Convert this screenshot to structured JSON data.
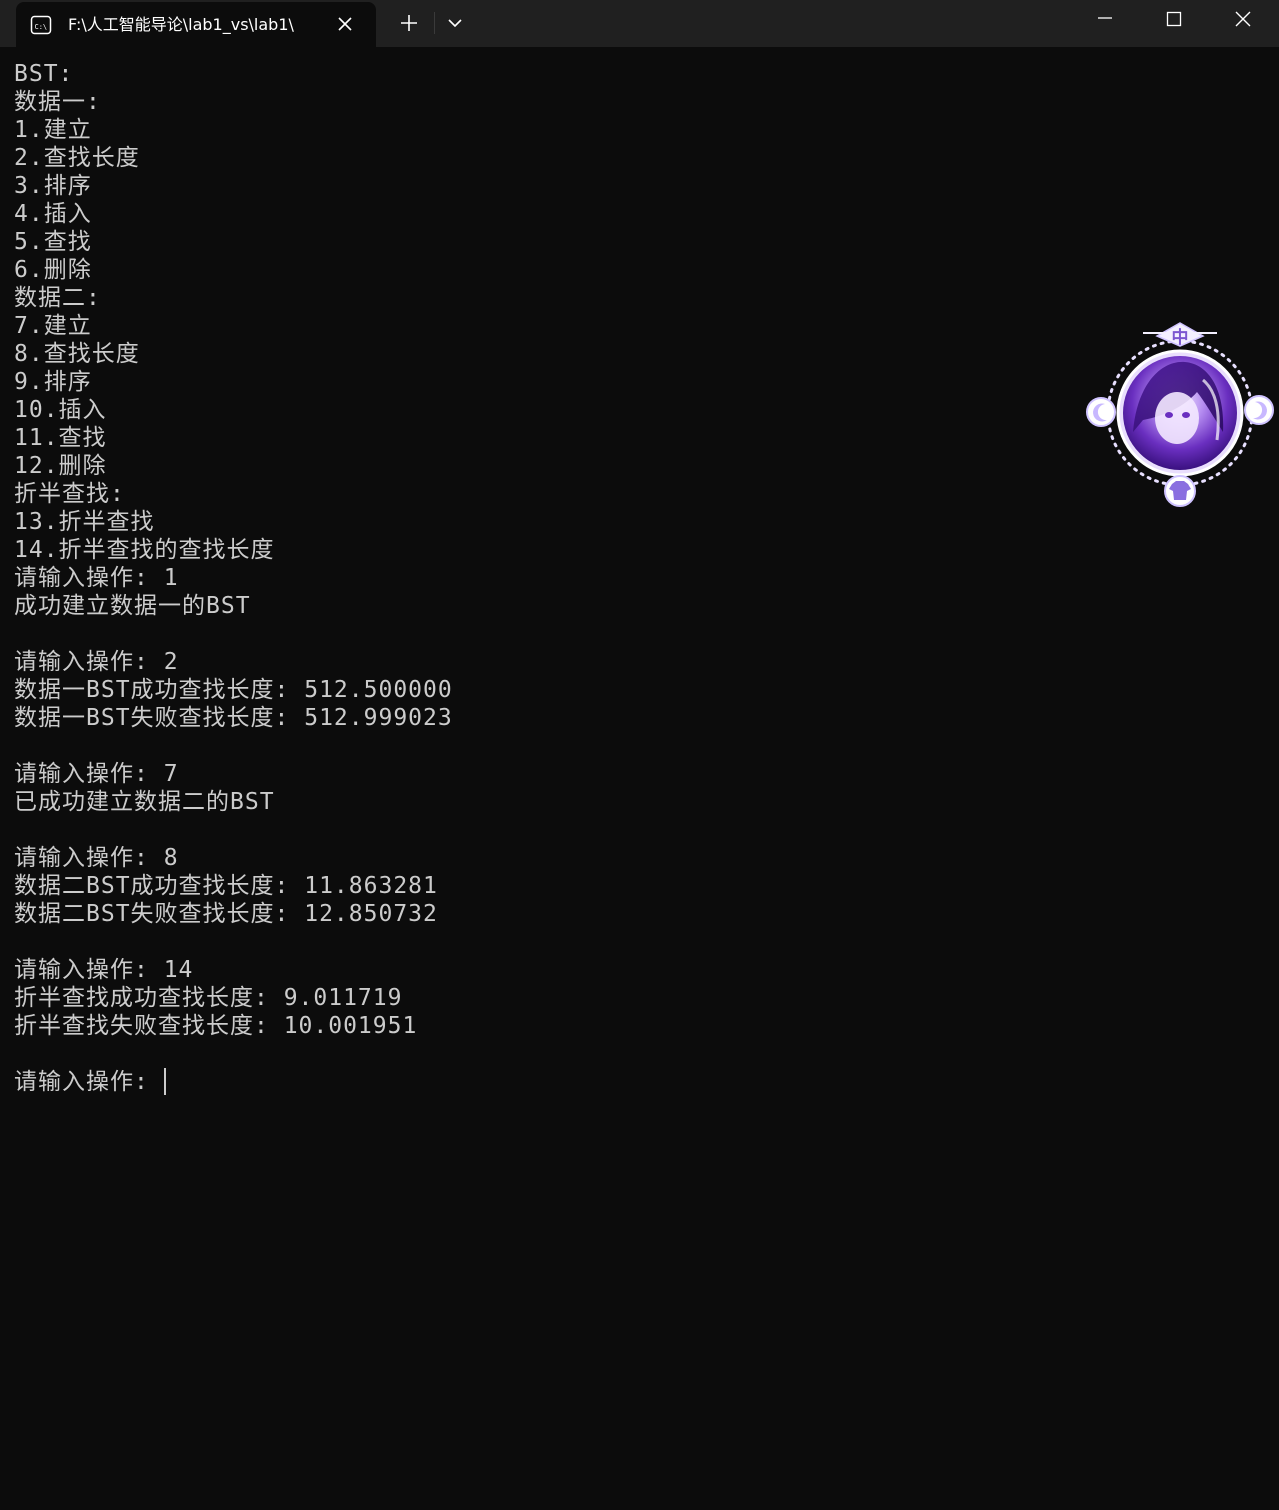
{
  "window": {
    "tab_title": "F:\\人工智能导论\\lab1_vs\\lab1\\",
    "icons": {
      "tab": "terminal-icon",
      "close_tab": "close-icon",
      "new_tab": "plus-icon",
      "tab_menu": "chevron-down-icon",
      "minimize": "minimize-icon",
      "maximize": "maximize-icon",
      "close": "close-icon"
    }
  },
  "console": {
    "lines": [
      "BST:",
      "数据一:",
      "1.建立",
      "2.查找长度",
      "3.排序",
      "4.插入",
      "5.查找",
      "6.删除",
      "数据二:",
      "7.建立",
      "8.查找长度",
      "9.排序",
      "10.插入",
      "11.查找",
      "12.删除",
      "折半查找:",
      "13.折半查找",
      "14.折半查找的查找长度",
      "请输入操作: 1",
      "成功建立数据一的BST",
      "",
      "请输入操作: 2",
      "数据一BST成功查找长度: 512.500000",
      "数据一BST失败查找长度: 512.999023",
      "",
      "请输入操作: 7",
      "已成功建立数据二的BST",
      "",
      "请输入操作: 8",
      "数据二BST成功查找长度: 11.863281",
      "数据二BST失败查找长度: 12.850732",
      "",
      "请输入操作: 14",
      "折半查找成功查找长度: 9.011719",
      "折半查找失败查找长度: 10.001951",
      ""
    ],
    "prompt": "请输入操作: "
  },
  "widget": {
    "badge_text": "中",
    "icons": {
      "avatar": "avatar-icon",
      "left": "moon-icon",
      "right": "moon-icon",
      "bottom": "shirt-icon"
    }
  },
  "colors": {
    "background": "#0c0c0c",
    "titlebar": "#202020",
    "text": "#cccccc",
    "accent_purple": "#8a4fd8"
  }
}
